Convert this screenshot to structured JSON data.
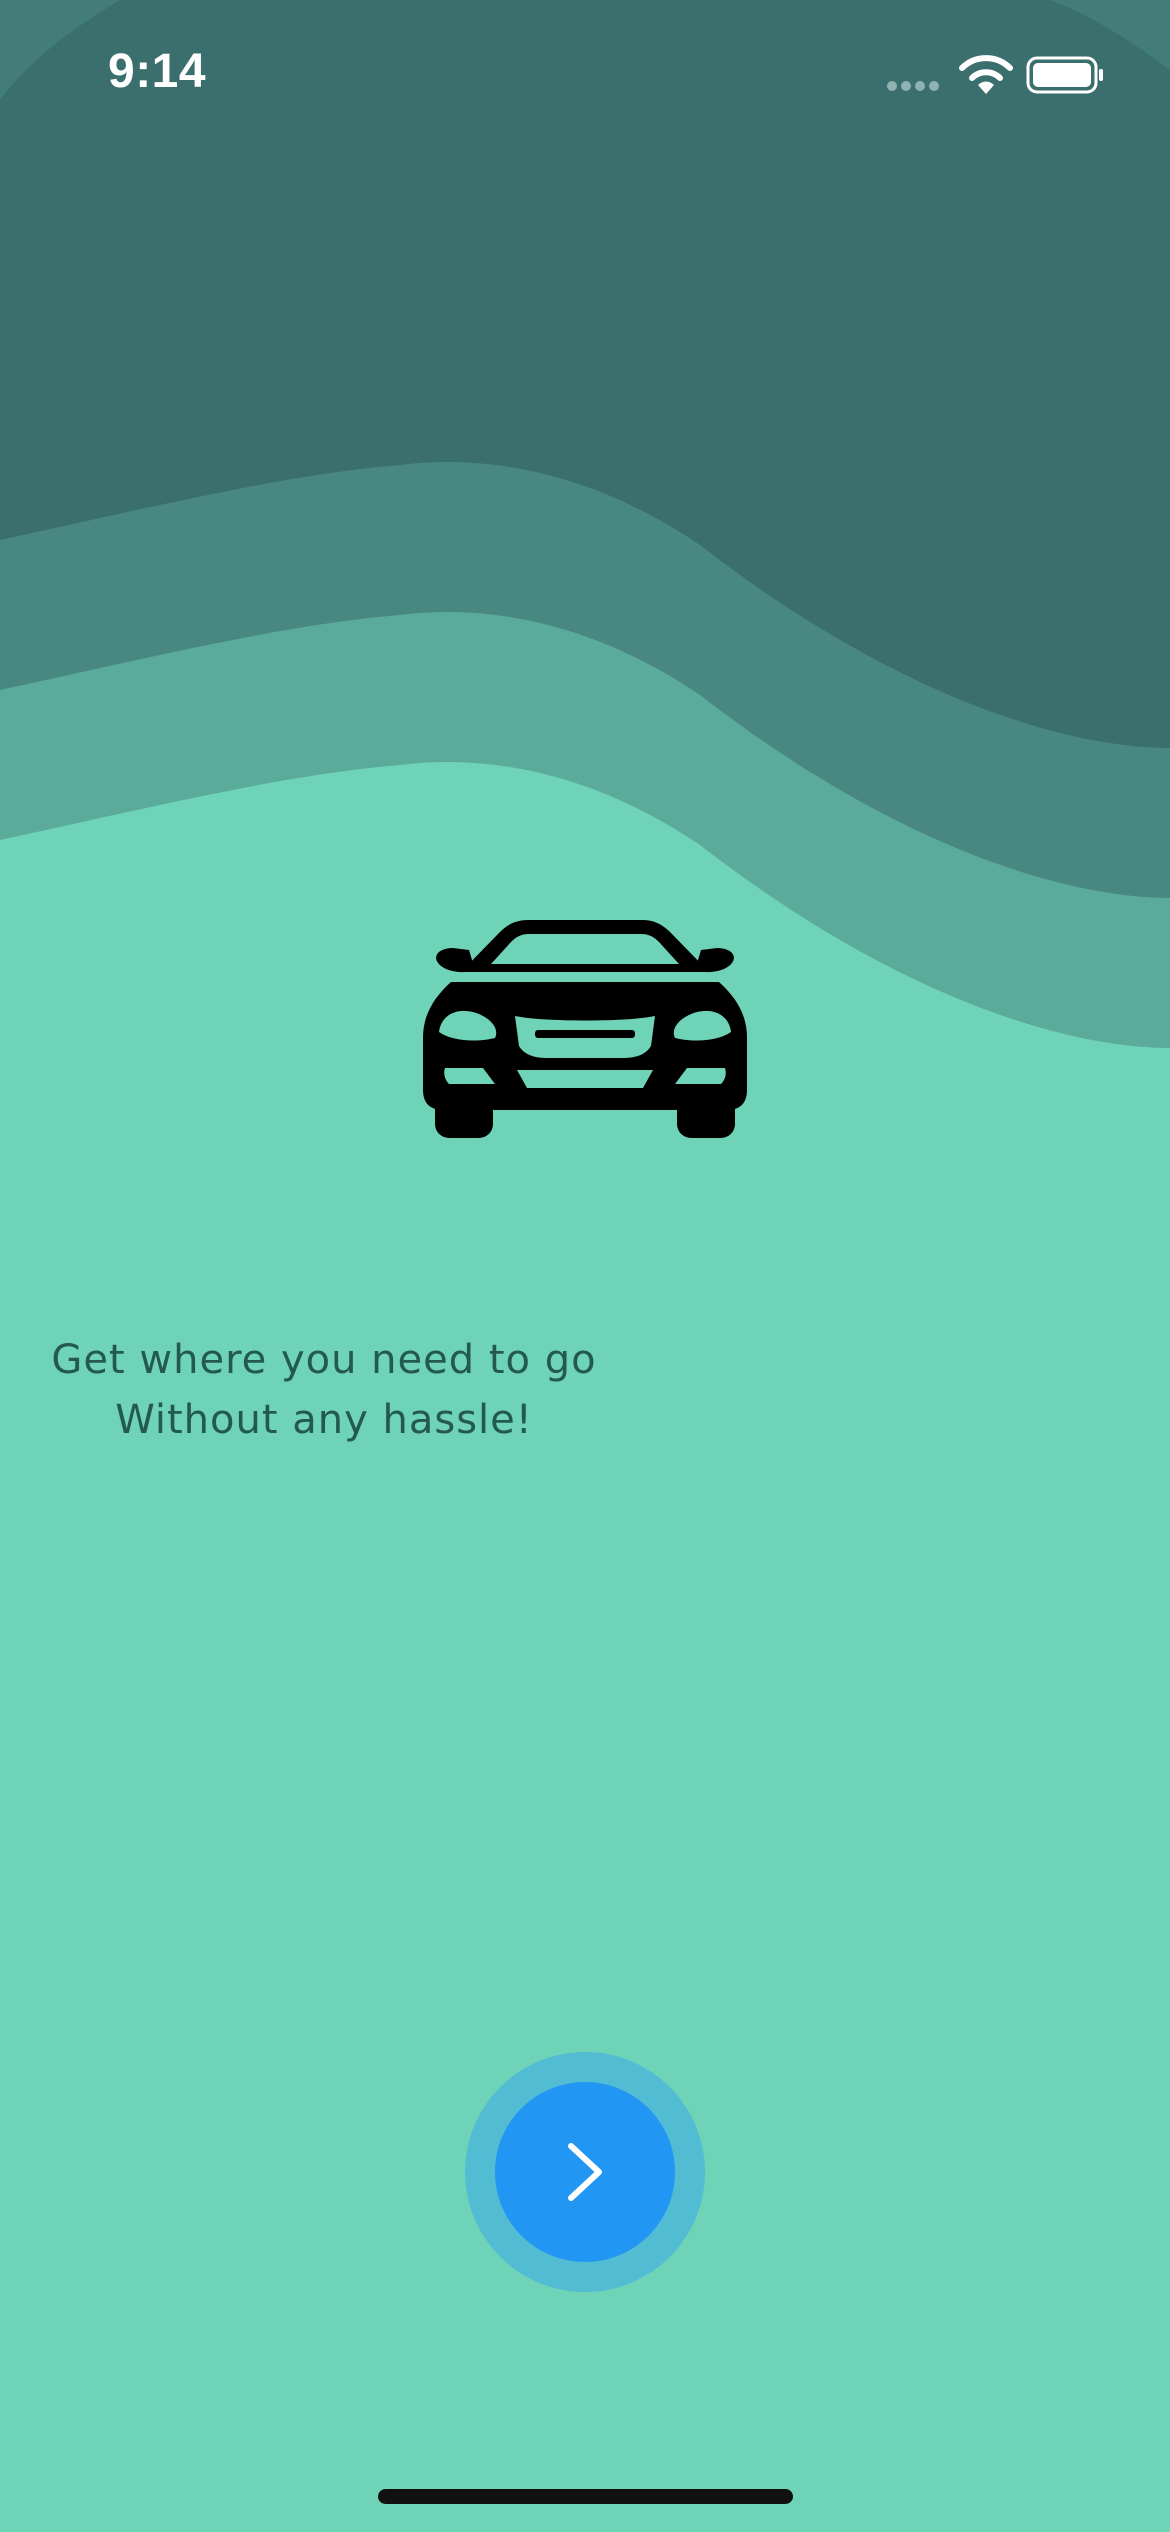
{
  "status_bar": {
    "time": "9:14",
    "icons": [
      "signal-icon",
      "wifi-icon",
      "battery-icon"
    ]
  },
  "hero": {
    "icon": "car-icon"
  },
  "tagline": {
    "line1": "Get where you need to go",
    "line2": "Without any hassle!"
  },
  "next_button": {
    "icon": "chevron-right-icon"
  },
  "colors": {
    "background": "#6fd3b8",
    "wave_dark": "#3b6f6e",
    "wave_mid": "#488880",
    "wave_light": "#5bab9a",
    "text": "#245a4e",
    "button_halo": "#52bcd3",
    "button": "#2196f3"
  }
}
